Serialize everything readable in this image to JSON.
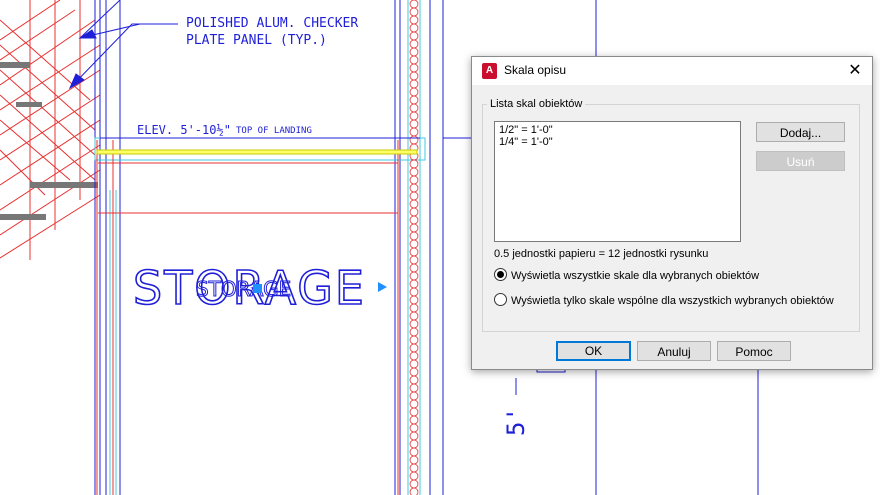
{
  "drawing": {
    "note_line1": "POLISHED ALUM. CHECKER",
    "note_line2": "PLATE PANEL (TYP.)",
    "elev_label": "ELEV. 5'-10½\"",
    "elev_suffix": "TOP OF LANDING",
    "room_label_large": "STORAGE",
    "room_label_small": "STORAGE",
    "dimension_text": "5'"
  },
  "dialog": {
    "title": "Skala opisu",
    "app_icon_letter": "A",
    "close_glyph": "✕",
    "group_label": "Lista skal obiektów",
    "scales": [
      "1/2\" = 1'-0\"",
      "1/4\" = 1'-0\""
    ],
    "add_button": "Dodaj...",
    "remove_button": "Usuń",
    "scale_info": "0.5 jednostki papieru = 12 jednostki rysunku",
    "radio_all": "Wyświetla wszystkie skale dla wybranych obiektów",
    "radio_common": "Wyświetla tylko skale wspólne dla wszystkich wybranych obiektów",
    "selected_radio": "all",
    "ok_button": "OK",
    "cancel_button": "Anuluj",
    "help_button": "Pomoc"
  },
  "colors": {
    "cad_blue": "#1f1fd8",
    "cad_red": "#e83030",
    "cad_cyan": "#40c8e0",
    "accent": "#0078d7"
  }
}
